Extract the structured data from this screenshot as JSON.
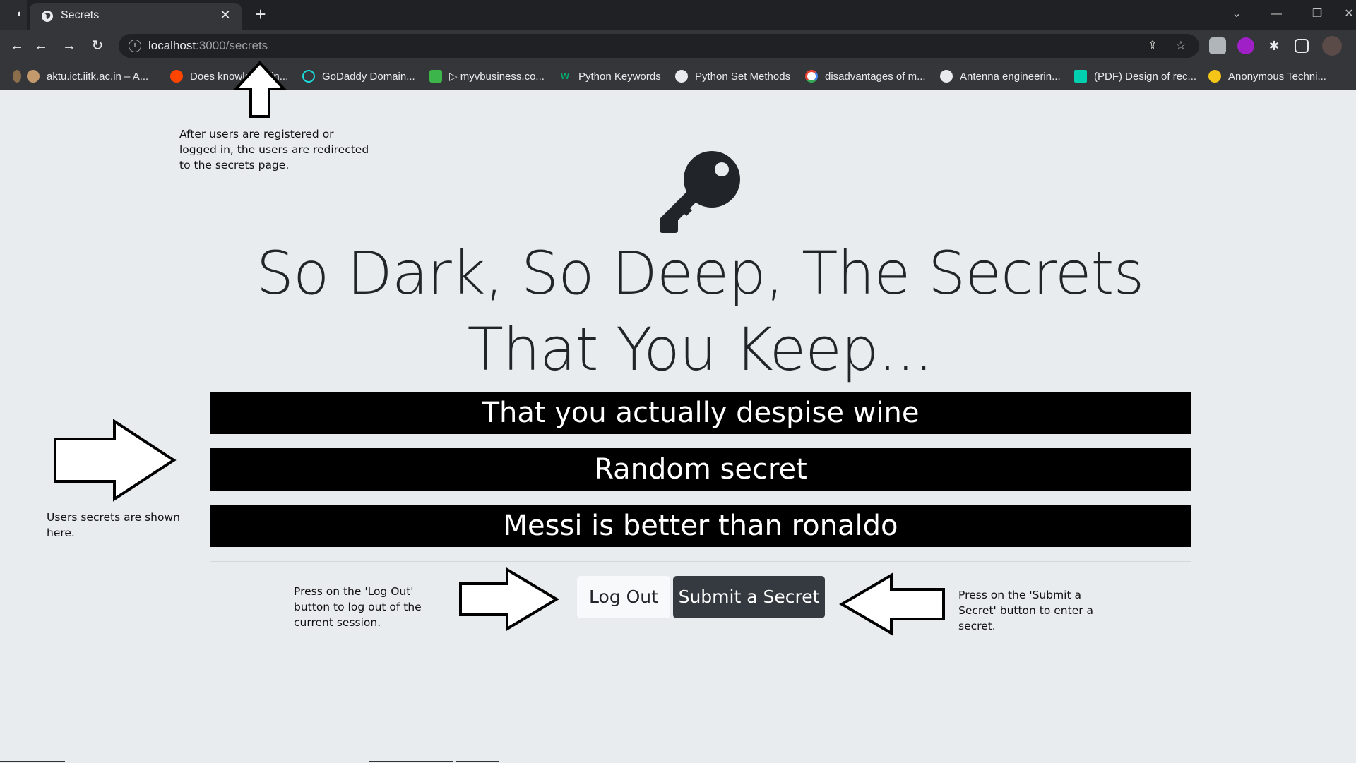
{
  "browser": {
    "tab_title": "Secrets",
    "tab_close_glyph": "✕",
    "new_tab_glyph": "+",
    "url_host": "localhost",
    "url_path": ":3000/secrets",
    "window_controls": [
      "⌄",
      "—",
      "❐",
      "✕"
    ],
    "nav": {
      "back": "←",
      "back2": "←",
      "forward": "→",
      "reload": "↻"
    },
    "bookmarks": [
      {
        "label": "aktu.ict.iitk.ac.in – A...",
        "icon": "aktu-icon",
        "color": "#c49a6c"
      },
      {
        "label": "Does knowledge in...",
        "icon": "reddit-icon",
        "color": "#ff4500"
      },
      {
        "label": "GoDaddy Domain...",
        "icon": "godaddy-icon",
        "color": "#1bdbdb"
      },
      {
        "label": "▷ myvbusiness.co...",
        "icon": "myvbusiness-icon",
        "color": "#3cb54a"
      },
      {
        "label": "Python Keywords",
        "icon": "w3-icon",
        "color": "#04aa6d"
      },
      {
        "label": "Python Set Methods",
        "icon": "globe-icon",
        "color": "#e8eaed"
      },
      {
        "label": "disadvantages of m...",
        "icon": "google-icon",
        "color": "#ffffff"
      },
      {
        "label": "Antenna engineerin...",
        "icon": "globe-icon",
        "color": "#e8eaed"
      },
      {
        "label": "(PDF) Design of rec...",
        "icon": "researchgate-icon",
        "color": "#00d0af"
      },
      {
        "label": "Anonymous Techni...",
        "icon": "anonymous-icon",
        "color": "#f5c518"
      }
    ]
  },
  "page": {
    "title": "So Dark, So Deep, The Secrets That You Keep...",
    "secrets": [
      "That you actually despise wine",
      "Random secret",
      "Messi is better than ronaldo"
    ],
    "logout_label": "Log Out",
    "submit_label": "Submit a Secret"
  },
  "annotations": {
    "redirect_note": "After users are registered or logged in, the users are redirected to the secrets page.",
    "secrets_note": "Users secrets are shown here.",
    "logout_note": "Press on the 'Log Out' button to log out of the current session.",
    "submit_note": "Press on the 'Submit a Secret' button to enter a secret."
  },
  "colors": {
    "page_bg": "#e9ecef",
    "secret_bg": "#000000",
    "dark_button": "#343a40",
    "light_button": "#f8f9fa"
  }
}
